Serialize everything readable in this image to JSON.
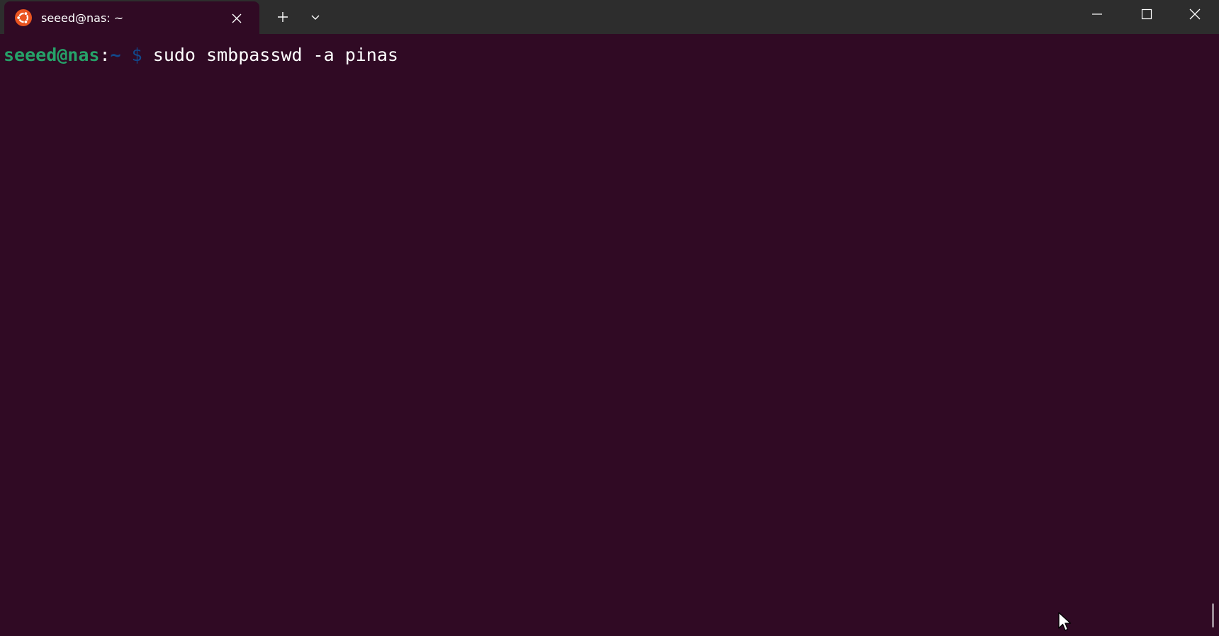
{
  "window": {
    "tab_title": "seeed@nas: ~",
    "icons": {
      "tab_icon": "ubuntu-logo-icon",
      "tab_close": "close-icon",
      "new_tab": "plus-icon",
      "dropdown": "chevron-down-icon",
      "minimize": "minimize-icon",
      "maximize": "maximize-icon",
      "close": "close-icon"
    }
  },
  "terminal": {
    "prompt_user_host": "seeed@nas",
    "prompt_colon": ":",
    "prompt_path": "~",
    "prompt_symbol": "$",
    "command": "sudo smbpasswd -a pinas"
  },
  "colors": {
    "terminal_bg": "#300a24",
    "titlebar_bg": "#2d2d2d",
    "prompt_user": "#26a269",
    "prompt_path": "#12488b",
    "ubuntu_orange": "#e95420"
  }
}
